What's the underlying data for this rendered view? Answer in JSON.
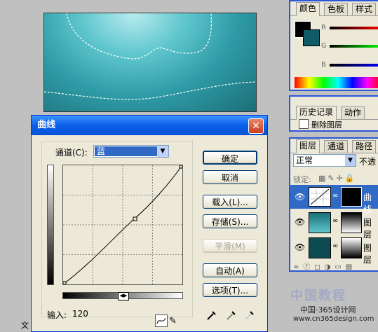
{
  "canvas": {
    "description_hidden": ""
  },
  "color_palette": {
    "tabs": [
      "颜色",
      "色板",
      "样式"
    ],
    "channels": [
      "R",
      "G",
      "B"
    ]
  },
  "history_palette": {
    "tabs": [
      "历史记录",
      "动作"
    ],
    "item": "删除图层"
  },
  "layers_palette": {
    "tabs": [
      "图层",
      "通道",
      "路径"
    ],
    "blend_mode": "正常",
    "opacity_label": "不透",
    "lock_label": "锁定:",
    "layers": [
      {
        "name": "曲线",
        "selected": true
      },
      {
        "name": "图层",
        "selected": false
      },
      {
        "name": "图层",
        "selected": false
      }
    ]
  },
  "dialog": {
    "title": "曲线",
    "channel_label": "通道(C):",
    "channel_value": "蓝",
    "buttons": {
      "ok": "确定",
      "cancel": "取消",
      "load": "载入(L)...",
      "save": "存储(S)...",
      "smooth": "平滑(M)",
      "auto": "自动(A)",
      "options": "选项(T)..."
    },
    "input_label": "输入:",
    "input_value": "120"
  },
  "watermark": {
    "line1": "中国教程",
    "line2": "中国·365设计网",
    "line3": "www.cn365design.com"
  },
  "partial_text_left": "文"
}
